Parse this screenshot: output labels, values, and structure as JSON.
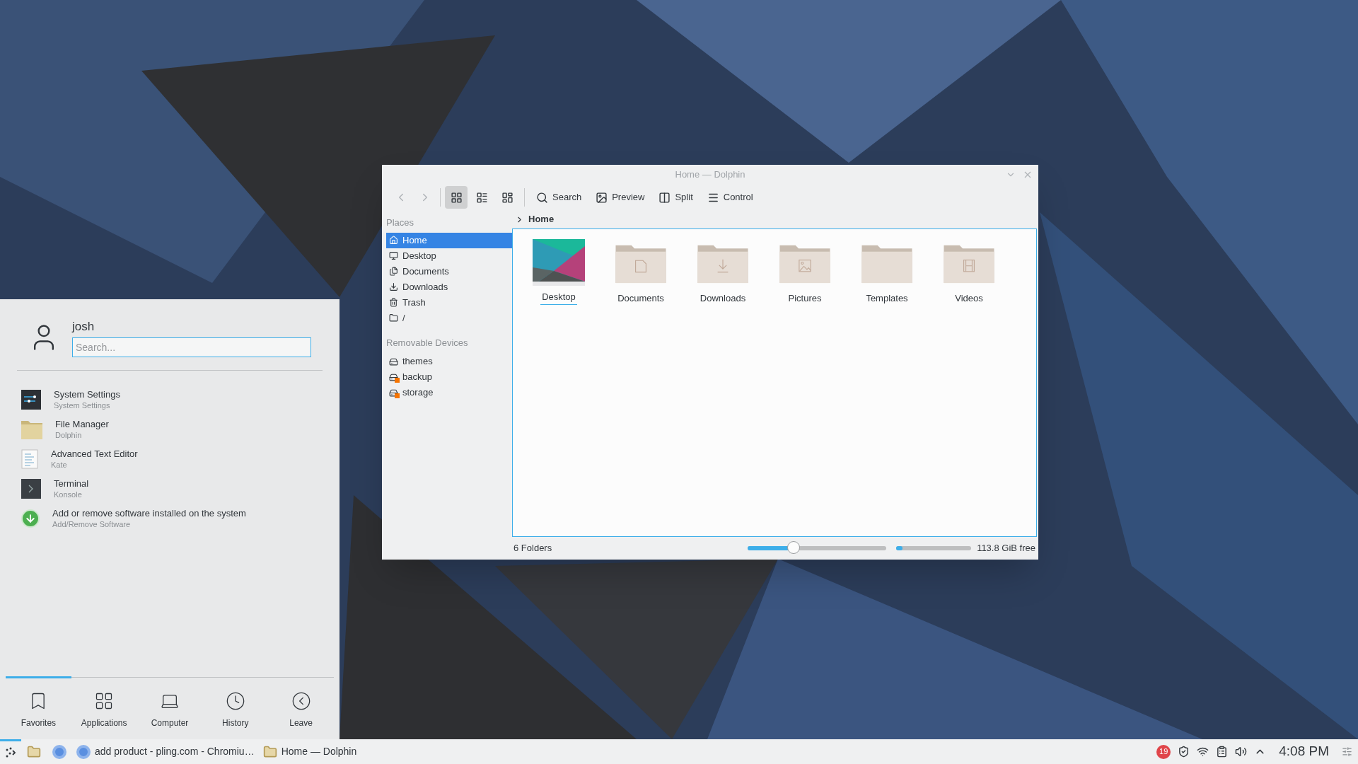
{
  "dolphin": {
    "title": "Home — Dolphin",
    "toolbar": [
      {
        "kind": "search",
        "label": "Search"
      },
      {
        "kind": "preview",
        "label": "Preview"
      },
      {
        "kind": "split",
        "label": "Split"
      },
      {
        "kind": "control",
        "label": "Control"
      }
    ],
    "view_modes": [
      {
        "kind": "icons",
        "selected": true
      },
      {
        "kind": "compact",
        "selected": false
      },
      {
        "kind": "details",
        "selected": false
      }
    ],
    "places": {
      "heading": "Places",
      "items": [
        {
          "kind": "home",
          "label": "Home",
          "selected": true
        },
        {
          "kind": "desktop",
          "label": "Desktop",
          "selected": false
        },
        {
          "kind": "documents",
          "label": "Documents",
          "selected": false
        },
        {
          "kind": "downloads",
          "label": "Downloads",
          "selected": false
        },
        {
          "kind": "trash",
          "label": "Trash",
          "selected": false
        },
        {
          "kind": "root",
          "label": "/",
          "selected": false
        }
      ]
    },
    "removable": {
      "heading": "Removable Devices",
      "items": [
        {
          "label": "themes",
          "mounted": true
        },
        {
          "label": "backup",
          "mounted": false
        },
        {
          "label": "storage",
          "mounted": false
        }
      ]
    },
    "breadcrumb": "Home",
    "files": [
      {
        "kind": "thumbnail",
        "name": "Desktop",
        "focused": true
      },
      {
        "kind": "documents",
        "name": "Documents",
        "focused": false
      },
      {
        "kind": "downloads",
        "name": "Downloads",
        "focused": false
      },
      {
        "kind": "pictures",
        "name": "Pictures",
        "focused": false
      },
      {
        "kind": "plain",
        "name": "Templates",
        "focused": false
      },
      {
        "kind": "videos",
        "name": "Videos",
        "focused": false
      }
    ],
    "status": {
      "text": "6 Folders",
      "zoom": {
        "level": 0.33
      },
      "space": {
        "level": 0.08
      },
      "free": "113.8 GiB free"
    }
  },
  "launcher": {
    "user": "josh",
    "search": {
      "placeholder": "Search..."
    },
    "apps": [
      {
        "kind": "settings",
        "name": "System Settings",
        "subtitle": "System Settings"
      },
      {
        "kind": "files",
        "name": "File Manager",
        "subtitle": "Dolphin"
      },
      {
        "kind": "editor",
        "name": "Advanced Text Editor",
        "subtitle": "Kate"
      },
      {
        "kind": "terminal",
        "name": "Terminal",
        "subtitle": "Konsole"
      },
      {
        "kind": "software",
        "name": "Add or remove software installed on the system",
        "subtitle": "Add/Remove Software"
      }
    ],
    "tabs": [
      {
        "kind": "favorites",
        "label": "Favorites",
        "selected": true
      },
      {
        "kind": "applications",
        "label": "Applications",
        "selected": false
      },
      {
        "kind": "computer",
        "label": "Computer",
        "selected": false
      },
      {
        "kind": "history",
        "label": "History",
        "selected": false
      },
      {
        "kind": "leave",
        "label": "Leave",
        "selected": false
      }
    ]
  },
  "taskbar": {
    "tasks": [
      {
        "kind": "browser",
        "label": "add product - pling.com - Chromiu…"
      },
      {
        "kind": "folder",
        "label": "Home — Dolphin"
      }
    ],
    "notification_count": "19",
    "clock": "4:08 PM"
  }
}
